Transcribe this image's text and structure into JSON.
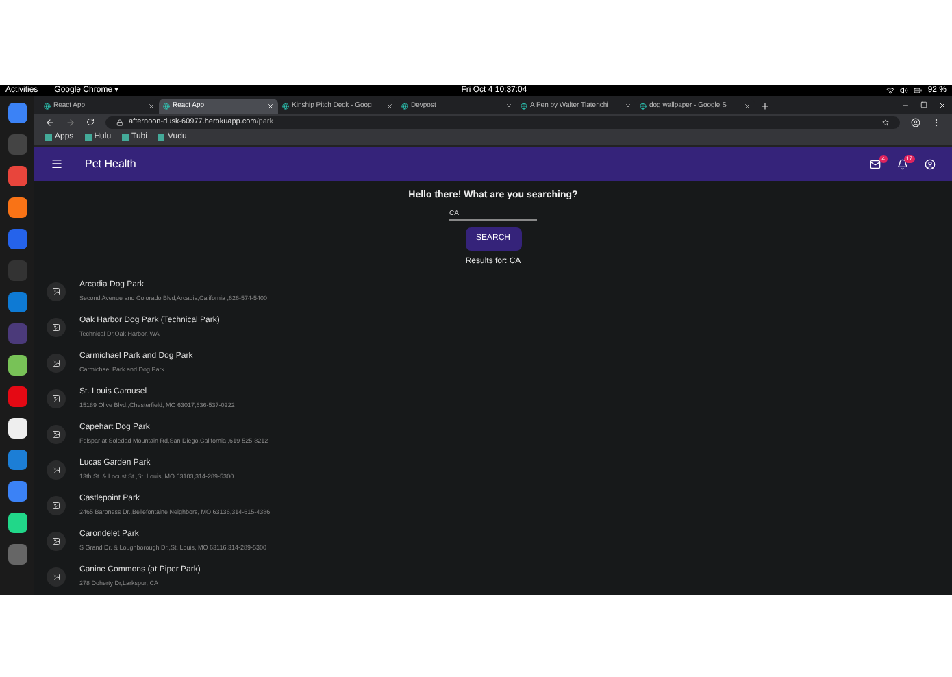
{
  "top_bar": {
    "activities": "Activities",
    "app_menu": "Google Chrome ▾",
    "clock": "Fri Oct 4  10:37:04",
    "battery": "92 %"
  },
  "tabs": [
    {
      "title": "React App",
      "selected": false
    },
    {
      "title": "React App",
      "selected": true
    },
    {
      "title": "Kinship Pitch Deck - Goog",
      "selected": false
    },
    {
      "title": "Devpost",
      "selected": false
    },
    {
      "title": "A Pen by Walter Tlatenchi",
      "selected": false
    },
    {
      "title": "dog wallpaper - Google S",
      "selected": false
    }
  ],
  "address": {
    "host": "afternoon-dusk-60977.herokuapp.com",
    "path": "/park"
  },
  "bookmarks": [
    "Apps",
    "Hulu",
    "Tubi",
    "Vudu"
  ],
  "app_bar": {
    "title": "Pet Health",
    "mail_count": "4",
    "notification_count": "17"
  },
  "heading": "Hello there! What are you searching?",
  "search": {
    "value": "CA"
  },
  "search_button": "SEARCH",
  "results_label": "Results for: CA",
  "results": [
    {
      "name": "Arcadia Dog Park",
      "address": "Second Avenue and Colorado Blvd,Arcadia,California ,626-574-5400"
    },
    {
      "name": "Oak Harbor Dog Park (Technical Park)",
      "address": "Technical Dr,Oak Harbor, WA"
    },
    {
      "name": "Carmichael Park and Dog Park",
      "address": "Carmichael Park and Dog Park"
    },
    {
      "name": "St. Louis Carousel",
      "address": "15189 Olive Blvd.,Chesterfield, MO 63017,636-537-0222"
    },
    {
      "name": "Capehart Dog Park",
      "address": "Felspar at Soledad Mountain Rd,San Diego,California ,619-525-8212"
    },
    {
      "name": "Lucas Garden Park",
      "address": "13th St. & Locust St.,St. Louis, MO 63103,314-289-5300"
    },
    {
      "name": "Castlepoint Park",
      "address": "2465 Baroness Dr.,Bellefontaine Neighbors, MO 63136,314-615-4386"
    },
    {
      "name": "Carondelet Park",
      "address": "S Grand Dr. & Loughborough Dr.,St. Louis, MO 63116,314-289-5300"
    },
    {
      "name": "Canine Commons (at Piper Park)",
      "address": "278 Doherty Dr,Larkspur, CA"
    }
  ]
}
